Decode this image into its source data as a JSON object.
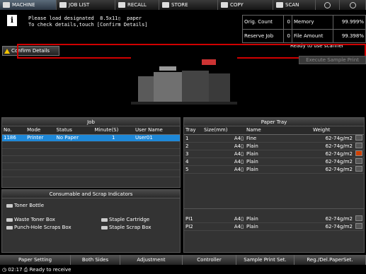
{
  "tabs": [
    {
      "label": "MACHINE",
      "icon": "machine-icon"
    },
    {
      "label": "JOB LIST",
      "icon": "job-list-icon"
    },
    {
      "label": "RECALL",
      "icon": "recall-icon"
    },
    {
      "label": "STORE",
      "icon": "store-icon"
    },
    {
      "label": "COPY",
      "icon": "copy-icon"
    },
    {
      "label": "SCAN",
      "icon": "scan-icon"
    }
  ],
  "message": {
    "line1": "Please load designated  8.5x11▯  paper",
    "line2": "To check details,touch [Confirm Details]"
  },
  "stats": {
    "orig_count_label": "Orig. Count",
    "orig_count": "0",
    "memory_label": "Memory",
    "memory": "99.999%",
    "reserve_job_label": "Reserve Job",
    "reserve_job": "0",
    "file_amount_label": "File Amount",
    "file_amount": "99.398%"
  },
  "ready_text": "Ready to use scanner",
  "confirm_button": "Confirm Details",
  "execute_button": "Execute Sample Print",
  "job_panel": {
    "title": "Job",
    "headers": [
      "No.",
      "Mode",
      "Status",
      "Minute(S)",
      "User Name"
    ],
    "rows": [
      [
        "1186",
        "Printer",
        "No Paper",
        "1",
        "User01"
      ]
    ]
  },
  "consumables": {
    "title": "Consumable and Scrap Indicators",
    "toner": "Toner Bottle",
    "waste": "Waste Toner Box",
    "punch": "Punch-Hole Scraps Box",
    "staple_cart": "Staple Cartridge",
    "staple_scrap": "Staple Scrap Box"
  },
  "tray_panel": {
    "title": "Paper Tray",
    "headers": [
      "Tray",
      "Size(mm)",
      "Name",
      "Weight"
    ],
    "rows": [
      {
        "tray": "1",
        "size": "A4▯",
        "name": "Fine",
        "weight": "62-74g/m2"
      },
      {
        "tray": "2",
        "size": "A4▯",
        "name": "Plain",
        "weight": "62-74g/m2"
      },
      {
        "tray": "3",
        "size": "A4▯",
        "name": "Plain",
        "weight": "62-74g/m2"
      },
      {
        "tray": "4",
        "size": "A4▯",
        "name": "Plain",
        "weight": "62-74g/m2"
      },
      {
        "tray": "5",
        "size": "A4▯",
        "name": "Plain",
        "weight": "62-74g/m2"
      }
    ],
    "pi_rows": [
      {
        "tray": "PI1",
        "size": "A4▯",
        "name": "Plain",
        "weight": "62-74g/m2"
      },
      {
        "tray": "PI2",
        "size": "A4▯",
        "name": "Plain",
        "weight": "62-74g/m2"
      }
    ]
  },
  "bottom_buttons": [
    "Paper Setting",
    "Both Sides",
    "Adjustment",
    "Controller",
    "Sample Print Set.",
    "Reg./Del.PaperSet."
  ],
  "status": {
    "time": "02:17",
    "text": "Ready to receive"
  }
}
